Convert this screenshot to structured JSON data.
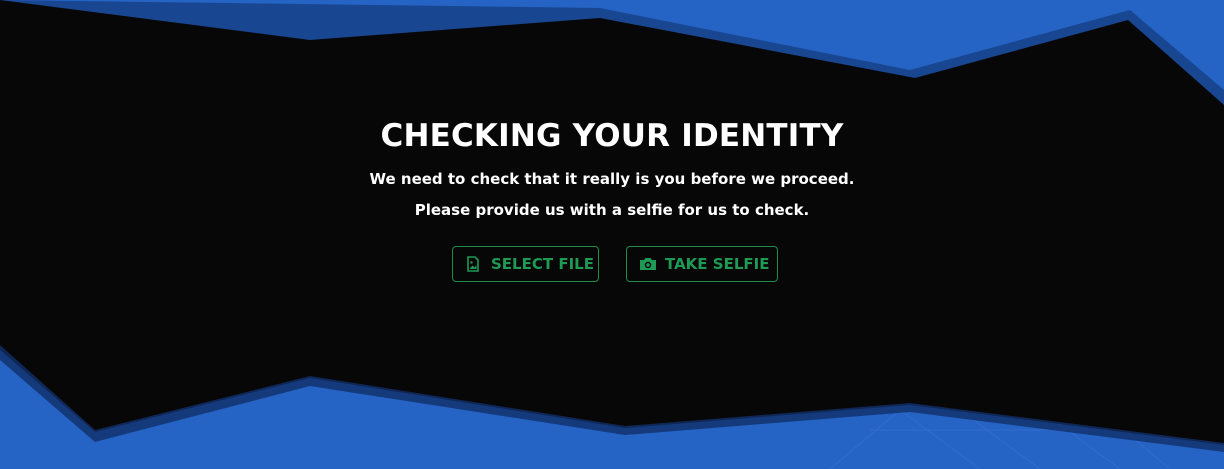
{
  "page": {
    "title": "CHECKING YOUR IDENTITY",
    "message_line1": "We need to check that it really is you before we proceed.",
    "message_line2": "Please provide us with a selfie for us to check."
  },
  "actions": {
    "select_file": {
      "label": "SELECT FILE",
      "icon": "image-file-icon"
    },
    "take_selfie": {
      "label": "TAKE SELFIE",
      "icon": "camera-icon"
    }
  },
  "colors": {
    "background_accent": "#2563c4",
    "panel": "#070707",
    "button_accent": "#1f9a55",
    "text": "#ffffff"
  }
}
